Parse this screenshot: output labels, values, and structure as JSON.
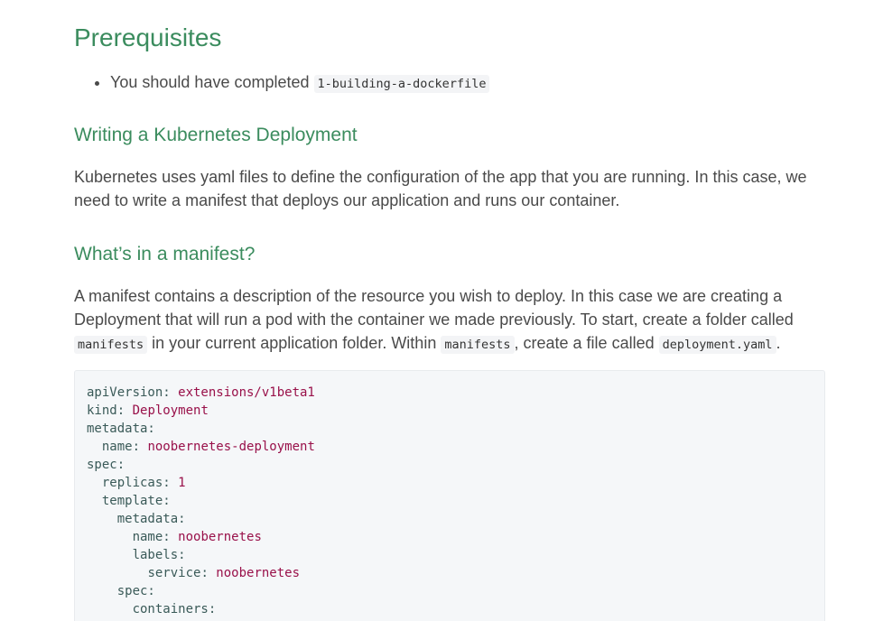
{
  "heading": "Prerequisites",
  "prereq": {
    "text": "You should have completed",
    "code": "1-building-a-dockerfile"
  },
  "section1": {
    "title": "Writing a Kubernetes Deployment",
    "body": "Kubernetes uses yaml files to define the configuration of the app that you are running. In this case, we need to write a manifest that deploys our application and runs our container."
  },
  "section2": {
    "title": "What’s in a manifest?",
    "body_part1": "A manifest contains a description of the resource you wish to deploy. In this case we are creating a Deployment that will run a pod with the container we made previously. To start, create a folder called",
    "code1": "manifests",
    "body_part2": "in your current application folder. Within",
    "code2": "manifests",
    "body_part3": ", create a file called",
    "code3": "deployment.yaml",
    "body_part4": "."
  },
  "code": {
    "lines": [
      {
        "indent": "",
        "key": "apiVersion:",
        "value": " extensions/v1beta1"
      },
      {
        "indent": "",
        "key": "kind:",
        "value": " Deployment"
      },
      {
        "indent": "",
        "key": "metadata:",
        "value": ""
      },
      {
        "indent": "  ",
        "key": "name:",
        "value": " noobernetes-deployment"
      },
      {
        "indent": "",
        "key": "spec:",
        "value": ""
      },
      {
        "indent": "  ",
        "key": "replicas:",
        "value": " 1"
      },
      {
        "indent": "  ",
        "key": "template:",
        "value": ""
      },
      {
        "indent": "    ",
        "key": "metadata:",
        "value": ""
      },
      {
        "indent": "      ",
        "key": "name:",
        "value": " noobernetes"
      },
      {
        "indent": "      ",
        "key": "labels:",
        "value": ""
      },
      {
        "indent": "        ",
        "key": "service:",
        "value": " noobernetes"
      },
      {
        "indent": "    ",
        "key": "spec:",
        "value": ""
      },
      {
        "indent": "      ",
        "key": "containers:",
        "value": ""
      }
    ]
  }
}
